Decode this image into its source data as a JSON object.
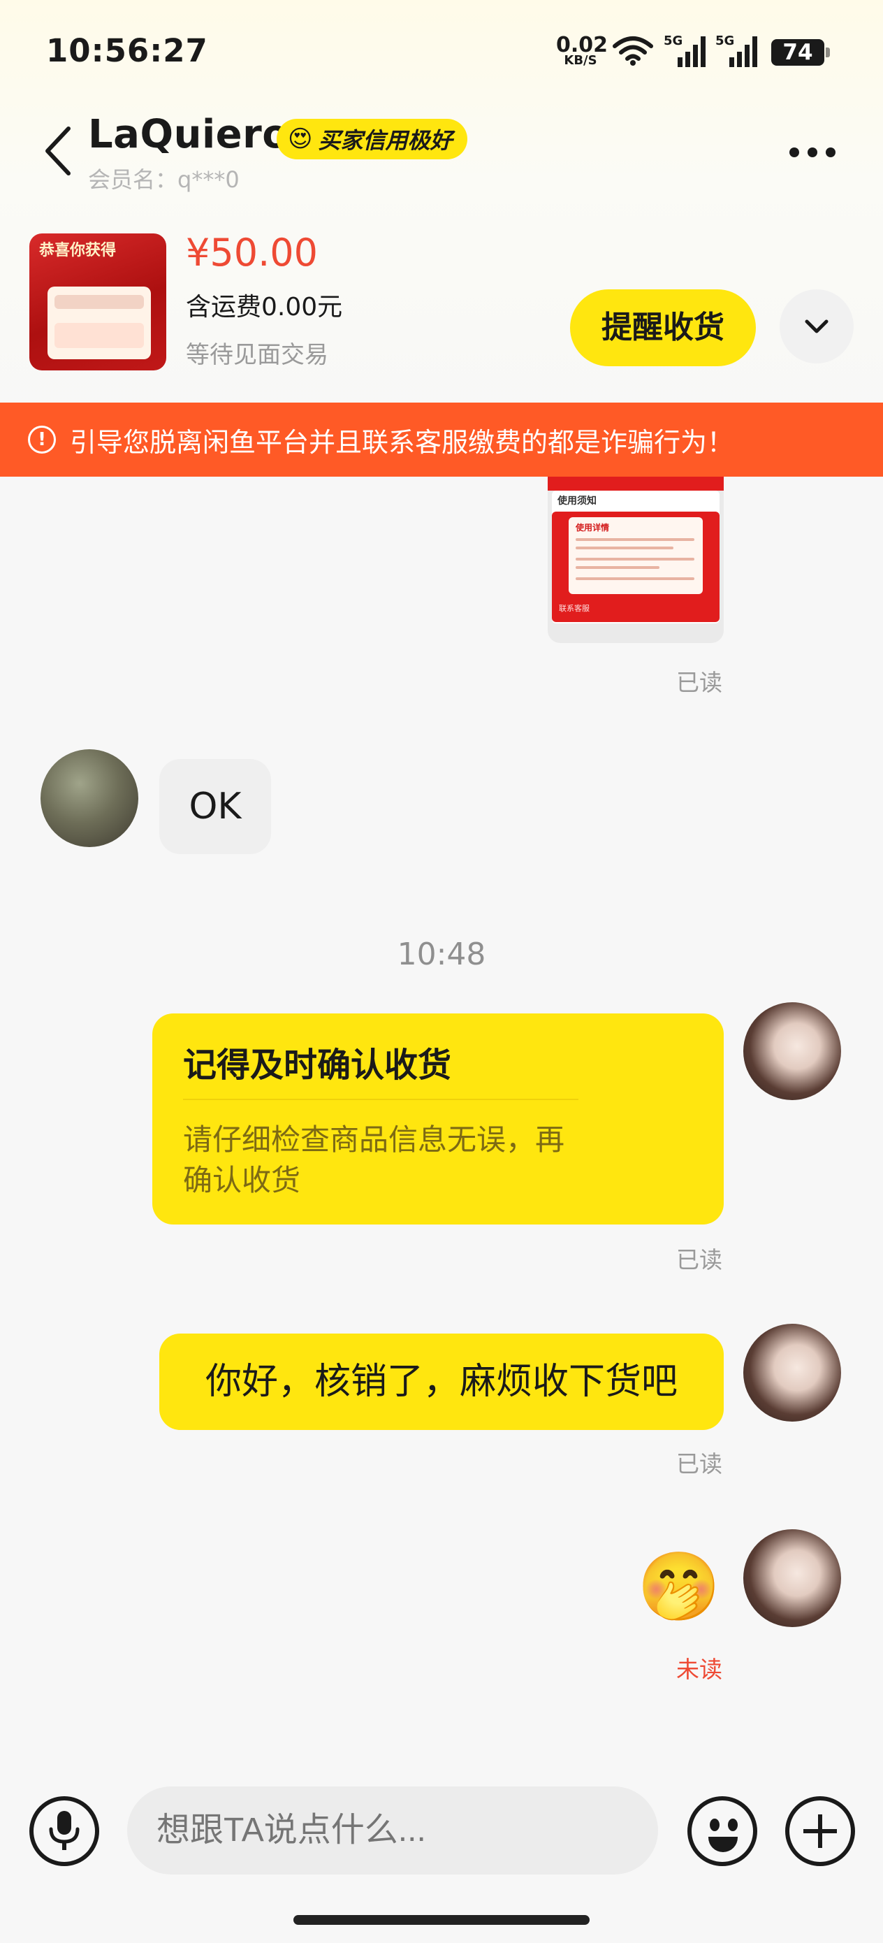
{
  "status_bar": {
    "time": "10:56:27",
    "net_speed": "0.02",
    "net_unit": "KB/S",
    "signal1": "5G",
    "signal2": "5G",
    "battery": "74"
  },
  "header": {
    "title": "LaQuiero",
    "subtitle": "会员名：q***0",
    "credit_emoji": "😍",
    "credit_label": "买家信用极好",
    "icons": [
      "back-arrow-icon",
      "more-icon"
    ]
  },
  "product": {
    "thumb_banner": "恭喜你获得",
    "price": "¥50.00",
    "shipping": "含运费0.00元",
    "status": "等待见面交易",
    "remind_button": "提醒收货",
    "expand_icon": "chevron-down-icon"
  },
  "warning": {
    "text": "引导您脱离闲鱼平台并且联系客服缴费的都是诈骗行为！",
    "icon": "alert-circle-icon"
  },
  "messages": {
    "image_msg": {
      "panel_label": "使用须知",
      "card_heading": "使用详情",
      "footer": "联系客服",
      "read": "已读"
    },
    "ok": {
      "text": "OK"
    },
    "timestamp": "10:48",
    "confirm_card": {
      "title": "记得及时确认收货",
      "body": "请仔细检查商品信息无误，再确认收货",
      "read": "已读"
    },
    "hello": {
      "text": "你好，核销了，麻烦收下货吧",
      "read": "已读"
    },
    "emoji": {
      "glyph": "🤭",
      "status": "未读"
    }
  },
  "input_bar": {
    "placeholder": "想跟TA说点什么...",
    "icons": [
      "microphone-icon",
      "emoji-icon",
      "plus-icon"
    ]
  },
  "colors": {
    "accent_yellow": "#ffe60f",
    "price_red": "#ee4a34",
    "warning_orange": "#ff5a26"
  }
}
